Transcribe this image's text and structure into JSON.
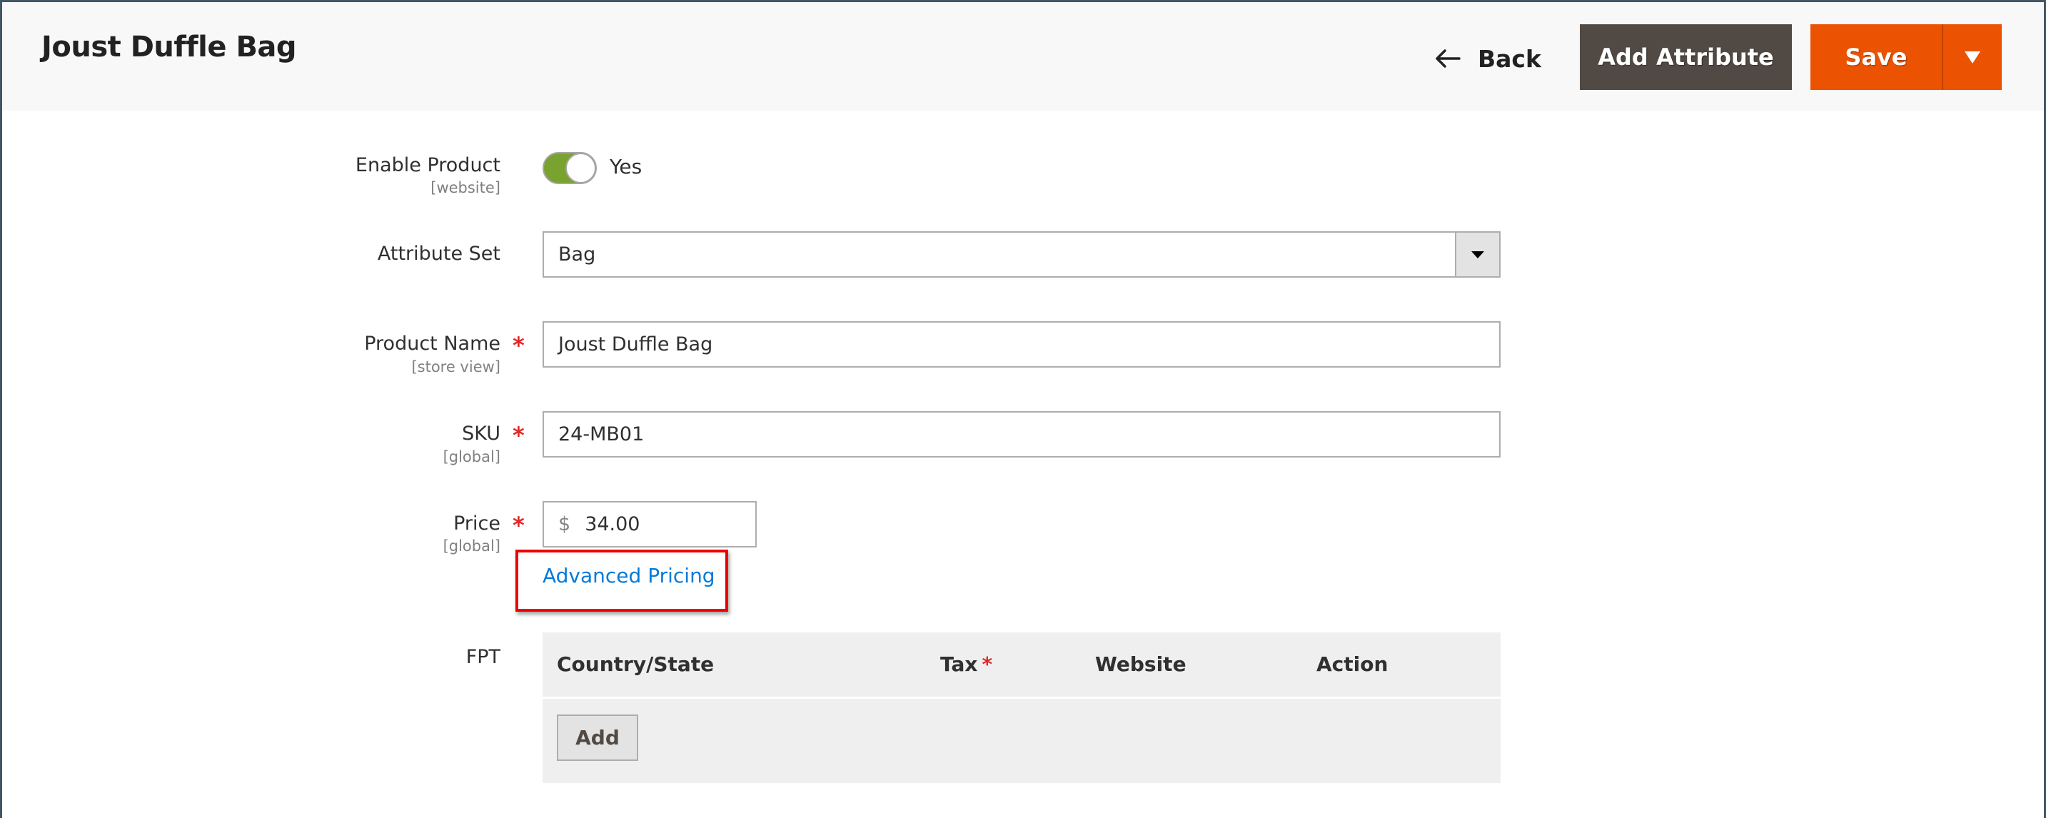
{
  "header": {
    "title": "Joust Duffle Bag",
    "back_label": "Back",
    "add_attribute_label": "Add Attribute",
    "save_label": "Save"
  },
  "colors": {
    "save": "#eb5202",
    "add_attribute": "#514943",
    "toggle_on": "#79a22e",
    "link": "#007bdb",
    "required": "#e22626",
    "highlight": "#ee0000"
  },
  "form": {
    "enable_product": {
      "label": "Enable Product",
      "scope": "[website]",
      "value": "Yes",
      "enabled": true
    },
    "attribute_set": {
      "label": "Attribute Set",
      "value": "Bag"
    },
    "product_name": {
      "label": "Product Name",
      "scope": "[store view]",
      "required": "*",
      "value": "Joust Duffle Bag"
    },
    "sku": {
      "label": "SKU",
      "scope": "[global]",
      "required": "*",
      "value": "24-MB01"
    },
    "price": {
      "label": "Price",
      "scope": "[global]",
      "required": "*",
      "currency": "$",
      "value": "34.00",
      "advanced_link": "Advanced Pricing"
    },
    "fpt": {
      "label": "FPT",
      "columns": [
        {
          "label": "Country/State",
          "required": ""
        },
        {
          "label": "Tax",
          "required": "*"
        },
        {
          "label": "Website",
          "required": ""
        },
        {
          "label": "Action",
          "required": ""
        }
      ],
      "add_label": "Add"
    }
  }
}
